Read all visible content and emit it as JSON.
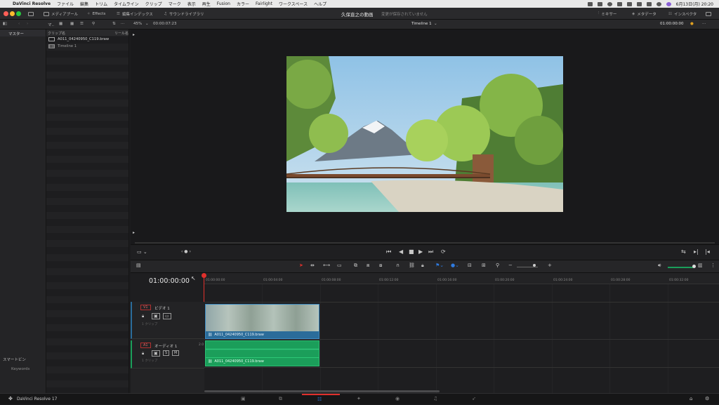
{
  "menubar": {
    "apple": "",
    "app": "DaVinci Resolve",
    "items": [
      "ファイル",
      "編集",
      "トリム",
      "タイムライン",
      "クリップ",
      "マーク",
      "表示",
      "再生",
      "Fusion",
      "カラー",
      "Fairlight",
      "ワークスペース",
      "ヘルプ"
    ],
    "datetime": "6月13日(月) 20:20"
  },
  "titlebar": {
    "media_pool": "メディアプール",
    "effects": "Effects",
    "edit_index": "編集インデックス",
    "sound_library": "サウンドライブラリ",
    "project_title": "久保直之の動画",
    "unsaved": "変更が保存されていません",
    "mixer": "ミキサー",
    "metadata": "メタデータ",
    "inspector": "インスペクタ"
  },
  "toolbar2": {
    "bin_short": "マ..",
    "zoom": "45%",
    "timecode_duration": "00:00:07:23",
    "timeline_name": "Timeline 1",
    "timecode_current": "01:00:00:00"
  },
  "bins": {
    "master": "マスター",
    "smart_bins": "スマートビン",
    "keywords": "Keywords"
  },
  "cliplist": {
    "col_name": "クリップ名",
    "col_reel": "リール名",
    "items": [
      {
        "name": "A011_04240950_C119.braw"
      },
      {
        "name": "Timeline 1"
      }
    ]
  },
  "timeline": {
    "timecode": "01:00:00:00",
    "ruler": [
      "01:00:00:00",
      "01:00:04:00",
      "01:00:08:00",
      "01:00:12:00",
      "01:00:16:00",
      "01:00:20:00",
      "01:00:24:00",
      "01:00:28:00",
      "01:00:32:00"
    ],
    "video_track": {
      "id": "V1",
      "name": "ビデオ 1",
      "sub": "1 クリップ",
      "clip": "A011_04240950_C119.braw"
    },
    "audio_track": {
      "id": "A1",
      "name": "オーディオ 1",
      "level": "2.0",
      "sub": "1 クリップ",
      "solo": "S",
      "mute": "M",
      "clip": "A011_04240950_C119.braw"
    }
  },
  "bottombar": {
    "app_version": "DaVinci Resolve 17"
  },
  "colors": {
    "accent_red": "#e0302c",
    "clip_blue": "#2b6c9a",
    "audio_green": "#1b9e5a"
  }
}
